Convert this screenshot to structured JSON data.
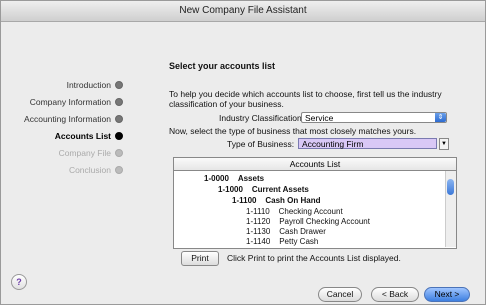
{
  "window": {
    "title": "New Company File Assistant"
  },
  "steps": [
    {
      "label": "Introduction",
      "state": "done"
    },
    {
      "label": "Company Information",
      "state": "done"
    },
    {
      "label": "Accounting Information",
      "state": "done"
    },
    {
      "label": "Accounts List",
      "state": "current"
    },
    {
      "label": "Company File",
      "state": "disabled"
    },
    {
      "label": "Conclusion",
      "state": "disabled"
    }
  ],
  "main": {
    "heading": "Select your accounts list",
    "intro": "To help you decide which accounts list to choose, first tell us the industry classification of your business.",
    "industry_label": "Industry Classification:",
    "industry_value": "Service",
    "type_prompt": "Now, select the type of business that most closely matches yours.",
    "type_label": "Type of Business:",
    "type_value": "Accounting Firm",
    "list_header": "Accounts List",
    "accounts": [
      {
        "code": "1-0000",
        "name": "Assets",
        "level": 0
      },
      {
        "code": "1-1000",
        "name": "Current Assets",
        "level": 1
      },
      {
        "code": "1-1100",
        "name": "Cash On Hand",
        "level": 2
      },
      {
        "code": "1-1110",
        "name": "Checking Account",
        "level": 3
      },
      {
        "code": "1-1120",
        "name": "Payroll Checking Account",
        "level": 3
      },
      {
        "code": "1-1130",
        "name": "Cash Drawer",
        "level": 3
      },
      {
        "code": "1-1140",
        "name": "Petty Cash",
        "level": 3
      }
    ],
    "print_label": "Print",
    "print_note": "Click Print to print the Accounts List displayed."
  },
  "footer": {
    "help_label": "?",
    "cancel_label": "Cancel",
    "back_label": "< Back",
    "next_label": "Next >"
  }
}
